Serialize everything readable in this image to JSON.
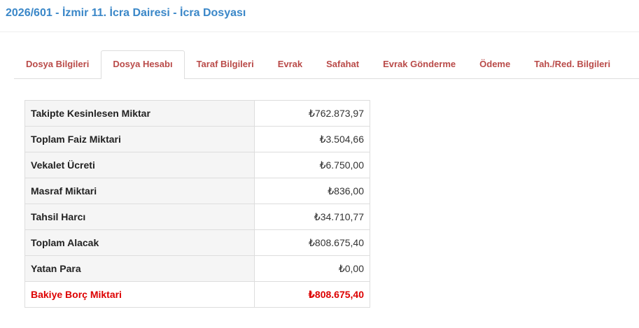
{
  "header": {
    "title": "2026/601 - İzmir 11. İcra Dairesi - İcra Dosyası"
  },
  "tabs": [
    {
      "label": "Dosya Bilgileri",
      "active": false
    },
    {
      "label": "Dosya Hesabı",
      "active": true
    },
    {
      "label": "Taraf Bilgileri",
      "active": false
    },
    {
      "label": "Evrak",
      "active": false
    },
    {
      "label": "Safahat",
      "active": false
    },
    {
      "label": "Evrak Gönderme",
      "active": false
    },
    {
      "label": "Ödeme",
      "active": false
    },
    {
      "label": "Tah./Red. Bilgileri",
      "active": false
    }
  ],
  "account": {
    "rows": [
      {
        "label": "Takipte Kesinlesen Miktar",
        "value": "₺762.873,97"
      },
      {
        "label": "Toplam Faiz Miktari",
        "value": "₺3.504,66"
      },
      {
        "label": "Vekalet Ücreti",
        "value": "₺6.750,00"
      },
      {
        "label": "Masraf Miktari",
        "value": "₺836,00"
      },
      {
        "label": "Tahsil Harcı",
        "value": "₺34.710,77"
      },
      {
        "label": "Toplam Alacak",
        "value": "₺808.675,40"
      },
      {
        "label": "Yatan Para",
        "value": "₺0,00"
      }
    ],
    "total": {
      "label": "Bakiye Borç Miktari",
      "value": "₺808.675,40"
    }
  },
  "colors": {
    "title": "#3a87c8",
    "tab_text": "#b94a48",
    "total_text": "#dd0000"
  }
}
